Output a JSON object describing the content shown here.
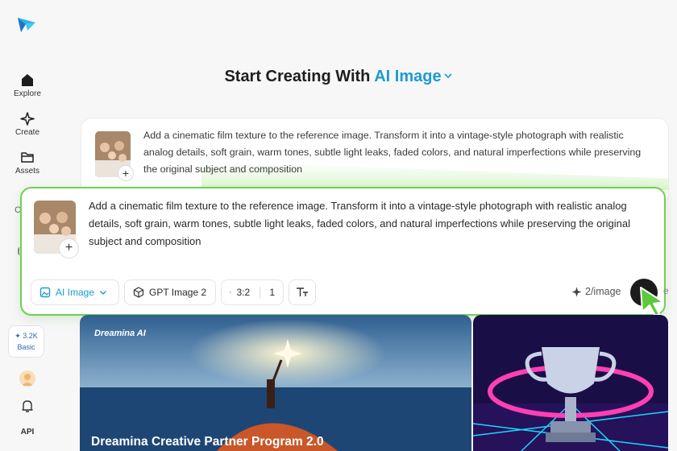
{
  "sidebar": {
    "items": [
      {
        "label": "Explore",
        "icon": "home-icon"
      },
      {
        "label": "Create",
        "icon": "sparkle-icon"
      },
      {
        "label": "Assets",
        "icon": "folder-icon"
      }
    ],
    "credits_value": "3.2K",
    "credits_plan": "Basic",
    "api_label": "API"
  },
  "heading": {
    "prefix": "Start Creating With",
    "mode": "AI Image"
  },
  "prompt_preview": {
    "text": "Add a cinematic film texture to the reference image. Transform it into a vintage-style photograph with realistic analog details, soft grain, warm tones, subtle light leaks, faded colors, and natural imperfections while preserving the original subject and composition"
  },
  "prompt_editor": {
    "text": "Add a cinematic film texture to the reference image. Transform it into a vintage-style photograph with realistic analog details, soft grain, warm tones, subtle light leaks, faded colors, and natural imperfections while preserving the original subject and composition",
    "mode_label": "AI Image",
    "model_label": "GPT Image 2",
    "ratio_label": "3:2",
    "count_label": "1",
    "cost_label": "2/image",
    "accent_color": "#1d9bd1",
    "border_color": "#6fd14c"
  },
  "feed": {
    "banner_brand": "Dreamina AI",
    "banner_title": "Dreamina Creative Partner Program 2.0"
  }
}
